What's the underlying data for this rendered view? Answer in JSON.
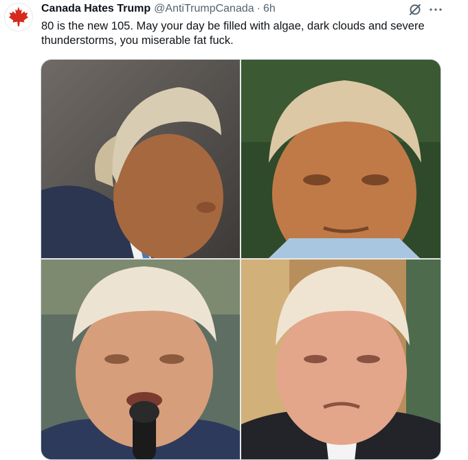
{
  "tweet": {
    "author_name": "Canada Hates Trump",
    "author_handle": "@AntiTrumpCanada",
    "separator": "·",
    "time_ago": "6h",
    "text": "80 is the new 105. May your day be filled with algae, dark clouds and severe thunderstorms, you miserable fat fuck.",
    "avatar_icon": "maple-leaf-icon",
    "avatar_color": "#d52b1e"
  },
  "actions": {
    "grok_icon": "grok-icon",
    "more_icon": "more-options-icon"
  },
  "media": {
    "photo_count": 4
  }
}
